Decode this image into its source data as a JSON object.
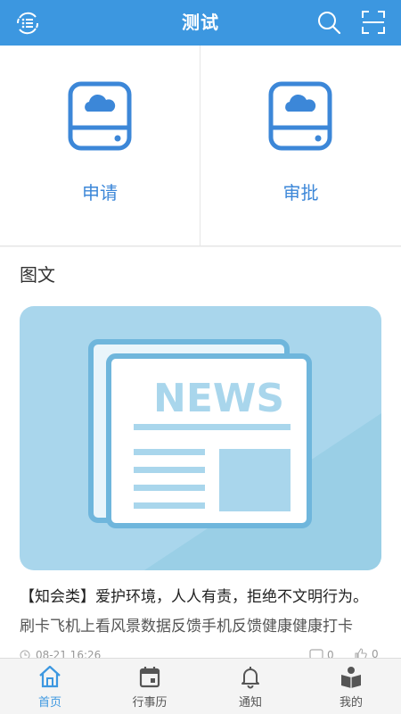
{
  "header": {
    "title": "测试",
    "menu_icon": "list-menu-icon",
    "search_icon": "search-icon",
    "scan_icon": "scan-icon"
  },
  "entries": [
    {
      "label": "申请",
      "icon": "cloud-drive-icon"
    },
    {
      "label": "审批",
      "icon": "cloud-drive-icon"
    }
  ],
  "section": {
    "title": "图文",
    "card": {
      "image_text": "NEWS",
      "title": "【知会类】爱护环境，人人有责，拒绝不文明行为。",
      "description": "刷卡飞机上看风景数据反馈手机反馈健康健康打卡",
      "time": "08-21 16:26",
      "comment_count": "0",
      "like_count": "0"
    }
  },
  "tabs": [
    {
      "label": "首页",
      "icon": "home-icon",
      "active": true
    },
    {
      "label": "行事历",
      "icon": "calendar-icon",
      "active": false
    },
    {
      "label": "通知",
      "icon": "bell-icon",
      "active": false
    },
    {
      "label": "我的",
      "icon": "profile-book-icon",
      "active": false
    }
  ],
  "colors": {
    "brand": "#3c97e0",
    "entry_label": "#3c87d8",
    "news_bg": "#a9d6ec"
  }
}
